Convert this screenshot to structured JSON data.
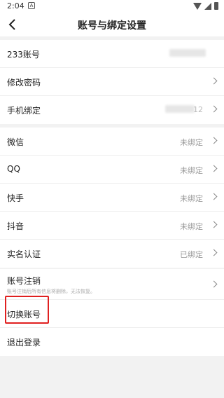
{
  "status_bar": {
    "time": "2:04",
    "notif": "A"
  },
  "header": {
    "title": "账号与绑定设置"
  },
  "account": {
    "id_label": "233账号",
    "password_label": "修改密码",
    "phone_label": "手机绑定",
    "phone_suffix": "12"
  },
  "bindings": [
    {
      "label": "微信",
      "value": "未绑定"
    },
    {
      "label": "QQ",
      "value": "未绑定"
    },
    {
      "label": "快手",
      "value": "未绑定"
    },
    {
      "label": "抖音",
      "value": "未绑定"
    },
    {
      "label": "实名认证",
      "value": "已绑定"
    }
  ],
  "cancel": {
    "label": "账号注销",
    "sub": "账号注销后所有信息将删除，无法恢复。"
  },
  "switch_label": "切换账号",
  "logout_label": "退出登录"
}
